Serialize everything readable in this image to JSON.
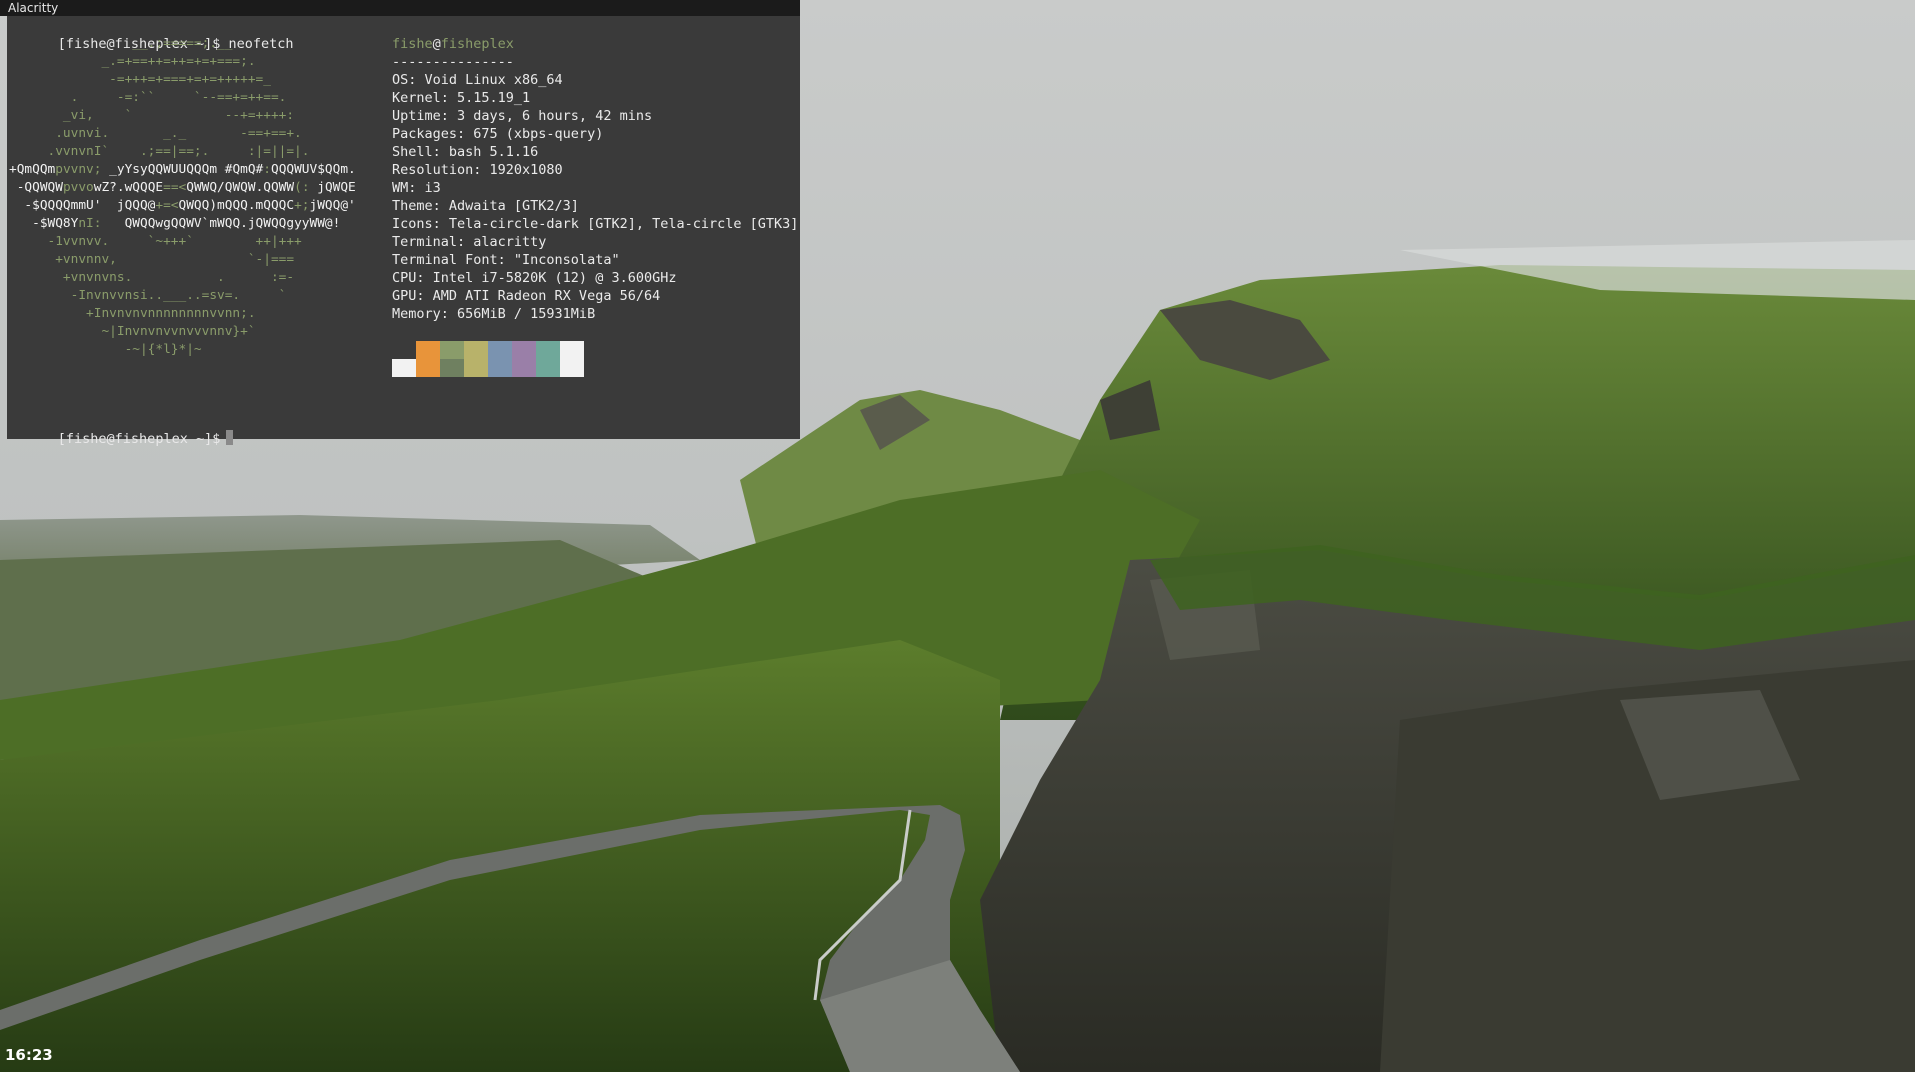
{
  "window": {
    "title": "Alacritty"
  },
  "terminal": {
    "prompt": "[fishe@fisheplex ~]$",
    "command": "neofetch",
    "ascii_logo": [
      [
        {
          "t": "                __.;=====;.__",
          "c": "g"
        }
      ],
      [
        {
          "t": "            _.=+==++=++=+=+===;.",
          "c": "g"
        }
      ],
      [
        {
          "t": "             -=+++=+===+=+=+++++=_",
          "c": "g"
        }
      ],
      [
        {
          "t": "        .     -=:``     `--==+=++==.",
          "c": "g"
        }
      ],
      [
        {
          "t": "       _vi,    `            --+=++++:",
          "c": "g"
        }
      ],
      [
        {
          "t": "      .uvnvi.       _._       -==+==+.",
          "c": "g"
        }
      ],
      [
        {
          "t": "     .vvnvnI`    .;==|==;.     :|=||=|.",
          "c": "g"
        }
      ],
      [
        {
          "t": "+QmQQm",
          "c": "w"
        },
        {
          "t": "pvvnv; ",
          "c": "g"
        },
        {
          "t": "_yYsyQQWUUQQQm #QmQ#",
          "c": "w"
        },
        {
          "t": ":",
          "c": "g"
        },
        {
          "t": "QQQWUV$QQm.",
          "c": "w"
        }
      ],
      [
        {
          "t": " -QQWQW",
          "c": "w"
        },
        {
          "t": "pvvo",
          "c": "g"
        },
        {
          "t": "wZ?.wQQQE",
          "c": "w"
        },
        {
          "t": "==<",
          "c": "g"
        },
        {
          "t": "QWWQ/QWQW.QQWW",
          "c": "w"
        },
        {
          "t": "(: ",
          "c": "g"
        },
        {
          "t": "jQWQE",
          "c": "w"
        }
      ],
      [
        {
          "t": "  -$QQQQmmU'  jQQQ@",
          "c": "w"
        },
        {
          "t": "+=<",
          "c": "g"
        },
        {
          "t": "QWQQ)mQQQ.mQQQC",
          "c": "w"
        },
        {
          "t": "+;",
          "c": "g"
        },
        {
          "t": "jWQQ@'",
          "c": "w"
        }
      ],
      [
        {
          "t": "   -$WQ8Y",
          "c": "w"
        },
        {
          "t": "nI:   ",
          "c": "g"
        },
        {
          "t": "QWQQwgQQWV`mWQQ.jQWQQgyyWW@!",
          "c": "w"
        }
      ],
      [
        {
          "t": "     -1vvnvv.     `~+++`        ++|+++",
          "c": "g"
        }
      ],
      [
        {
          "t": "      +vnvnnv,                 `-|===",
          "c": "g"
        }
      ],
      [
        {
          "t": "       +vnvnvns.           .      :=-",
          "c": "g"
        }
      ],
      [
        {
          "t": "        -Invnvvnsi..___..=sv=.     `",
          "c": "g"
        }
      ],
      [
        {
          "t": "          +Invnvnvnnnnnnnnvvnn;.",
          "c": "g"
        }
      ],
      [
        {
          "t": "            ~|Invnvnvvnvvvnnv}+`",
          "c": "g"
        }
      ],
      [
        {
          "t": "               -~|{*l}*|~",
          "c": "g"
        }
      ]
    ],
    "info": {
      "user": "fishe",
      "at": "@",
      "host": "fisheplex",
      "separator": "---------------",
      "rows": [
        "OS: Void Linux x86_64",
        "Kernel: 5.15.19_1",
        "Uptime: 3 days, 6 hours, 42 mins",
        "Packages: 675 (xbps-query)",
        "Shell: bash 5.1.16",
        "Resolution: 1920x1080",
        "WM: i3",
        "Theme: Adwaita [GTK2/3]",
        "Icons: Tela-circle-dark [GTK2], Tela-circle [GTK3]",
        "Terminal: alacritty",
        "Terminal Font: \"Inconsolata\"",
        "CPU: Intel i7-5820K (12) @ 3.600GHz",
        "GPU: AMD ATI Radeon RX Vega 56/64",
        "Memory: 656MiB / 15931MiB"
      ]
    },
    "color_blocks": [
      {
        "top": "#3a3a3a",
        "bottom": "#f2f2f2"
      },
      {
        "top": "#e8943a",
        "bottom": "#e8943a"
      },
      {
        "top": "#8a9c6a",
        "bottom": "#6f8060"
      },
      {
        "top": "#b8b26a",
        "bottom": "#b8b26a"
      },
      {
        "top": "#7a93b0",
        "bottom": "#7a93b0"
      },
      {
        "top": "#9a7fa8",
        "bottom": "#9a7fa8"
      },
      {
        "top": "#6fa89a",
        "bottom": "#6fa89a"
      },
      {
        "top": "#f2f2f2",
        "bottom": "#f2f2f2"
      }
    ],
    "prompt2": "[fishe@fisheplex ~]$"
  },
  "statusbar": {
    "clock": "16:23"
  }
}
